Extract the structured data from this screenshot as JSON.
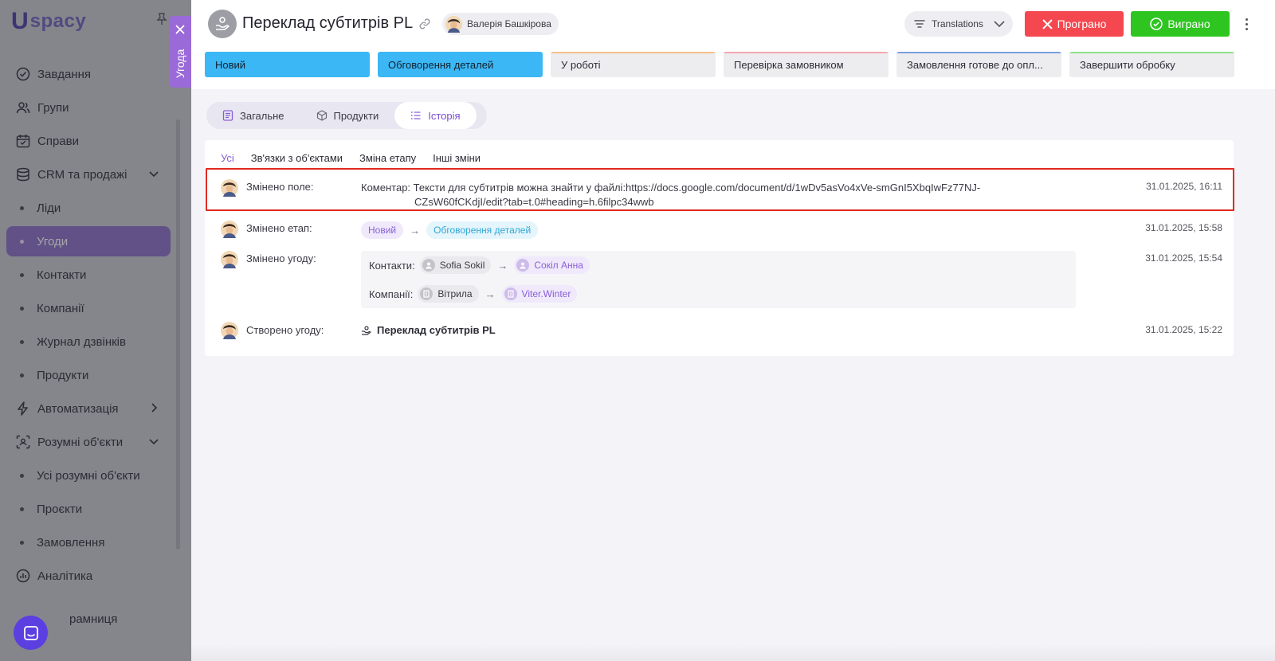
{
  "sidebar": {
    "logo": {
      "mark": "U",
      "text": "spacy"
    },
    "items": [
      {
        "label": "Завдання",
        "icon": "check-circle-icon"
      },
      {
        "label": "Групи",
        "icon": "users-icon"
      },
      {
        "label": "Справи",
        "icon": "calendar-icon"
      },
      {
        "label": "CRM та продажі",
        "icon": "database-icon",
        "expanded": true
      }
    ],
    "crm_sub": [
      "Ліди",
      "Угоди",
      "Контакти",
      "Компанії",
      "Журнал дзвінків",
      "Продукти"
    ],
    "crm_active": "Угоди",
    "automation": {
      "label": "Автоматизація",
      "icon": "lightning-icon"
    },
    "smart": {
      "label": "Розумні об'єкти",
      "icon": "scan-icon"
    },
    "smart_sub": [
      "Усі розумні об'єкти",
      "Проєкти",
      "Замовлення"
    ],
    "analytics": {
      "label": "Аналітика",
      "icon": "chart-icon"
    },
    "last": {
      "label": "рамниця"
    }
  },
  "deal_tab": {
    "label": "Угода"
  },
  "header": {
    "title": "Переклад субтитрів PL",
    "owner": "Валерія Башкірова",
    "filter_label": "Translations",
    "lost_label": "Програно",
    "won_label": "Виграно"
  },
  "stages": [
    {
      "label": "Новий",
      "state": "done",
      "color": "#3cb7f5"
    },
    {
      "label": "Обговорення деталей",
      "state": "done",
      "color": "#3cb7f5"
    },
    {
      "label": "У роботі",
      "state": "todo",
      "color": "#f6c08a"
    },
    {
      "label": "Перевірка замовником",
      "state": "todo",
      "color": "#f3a6b0"
    },
    {
      "label": "Замовлення готове до опл...",
      "state": "todo",
      "color": "#7a9fe0"
    },
    {
      "label": "Завершити обробку",
      "state": "todo",
      "color": "#8ee08a"
    }
  ],
  "tabs": [
    {
      "label": "Загальне",
      "icon": "document-icon"
    },
    {
      "label": "Продукти",
      "icon": "box-icon"
    },
    {
      "label": "Історія",
      "icon": "list-icon",
      "active": true
    }
  ],
  "history_filters": [
    "Усі",
    "Зв'язки з об'єктами",
    "Зміна етапу",
    "Інші зміни"
  ],
  "history": {
    "row1": {
      "action": "Змінено поле:",
      "field_label": "Коментар:",
      "line1": "Тексти для субтитрів можна знайти у файлі:https://docs.google.com/document/d/1wDv5asVo4xVe-smGnI5XbqIwFz77NJ-",
      "line2": "CZsW60fCKdjI/edit?tab=t.0#heading=h.6filpc34wwb",
      "time": "31.01.2025, 16:11"
    },
    "row2": {
      "action": "Змінено етап:",
      "from": "Новий",
      "to": "Обговорення деталей",
      "time": "31.01.2025, 15:58"
    },
    "row3": {
      "action": "Змінено угоду:",
      "contacts_label": "Контакти:",
      "contact_from": "Sofia Sokil",
      "contact_to": "Сокіл Анна",
      "companies_label": "Компанії:",
      "company_from": "Вітрила",
      "company_to": "Viter.Winter",
      "time": "31.01.2025, 15:54"
    },
    "row4": {
      "action": "Створено угоду:",
      "deal": "Переклад субтитрів PL",
      "time": "31.01.2025, 15:22"
    }
  },
  "colors": {
    "accent": "#8a5fd6",
    "lost": "#f5474f",
    "won": "#2ec521",
    "highlight": "#e1291f"
  }
}
